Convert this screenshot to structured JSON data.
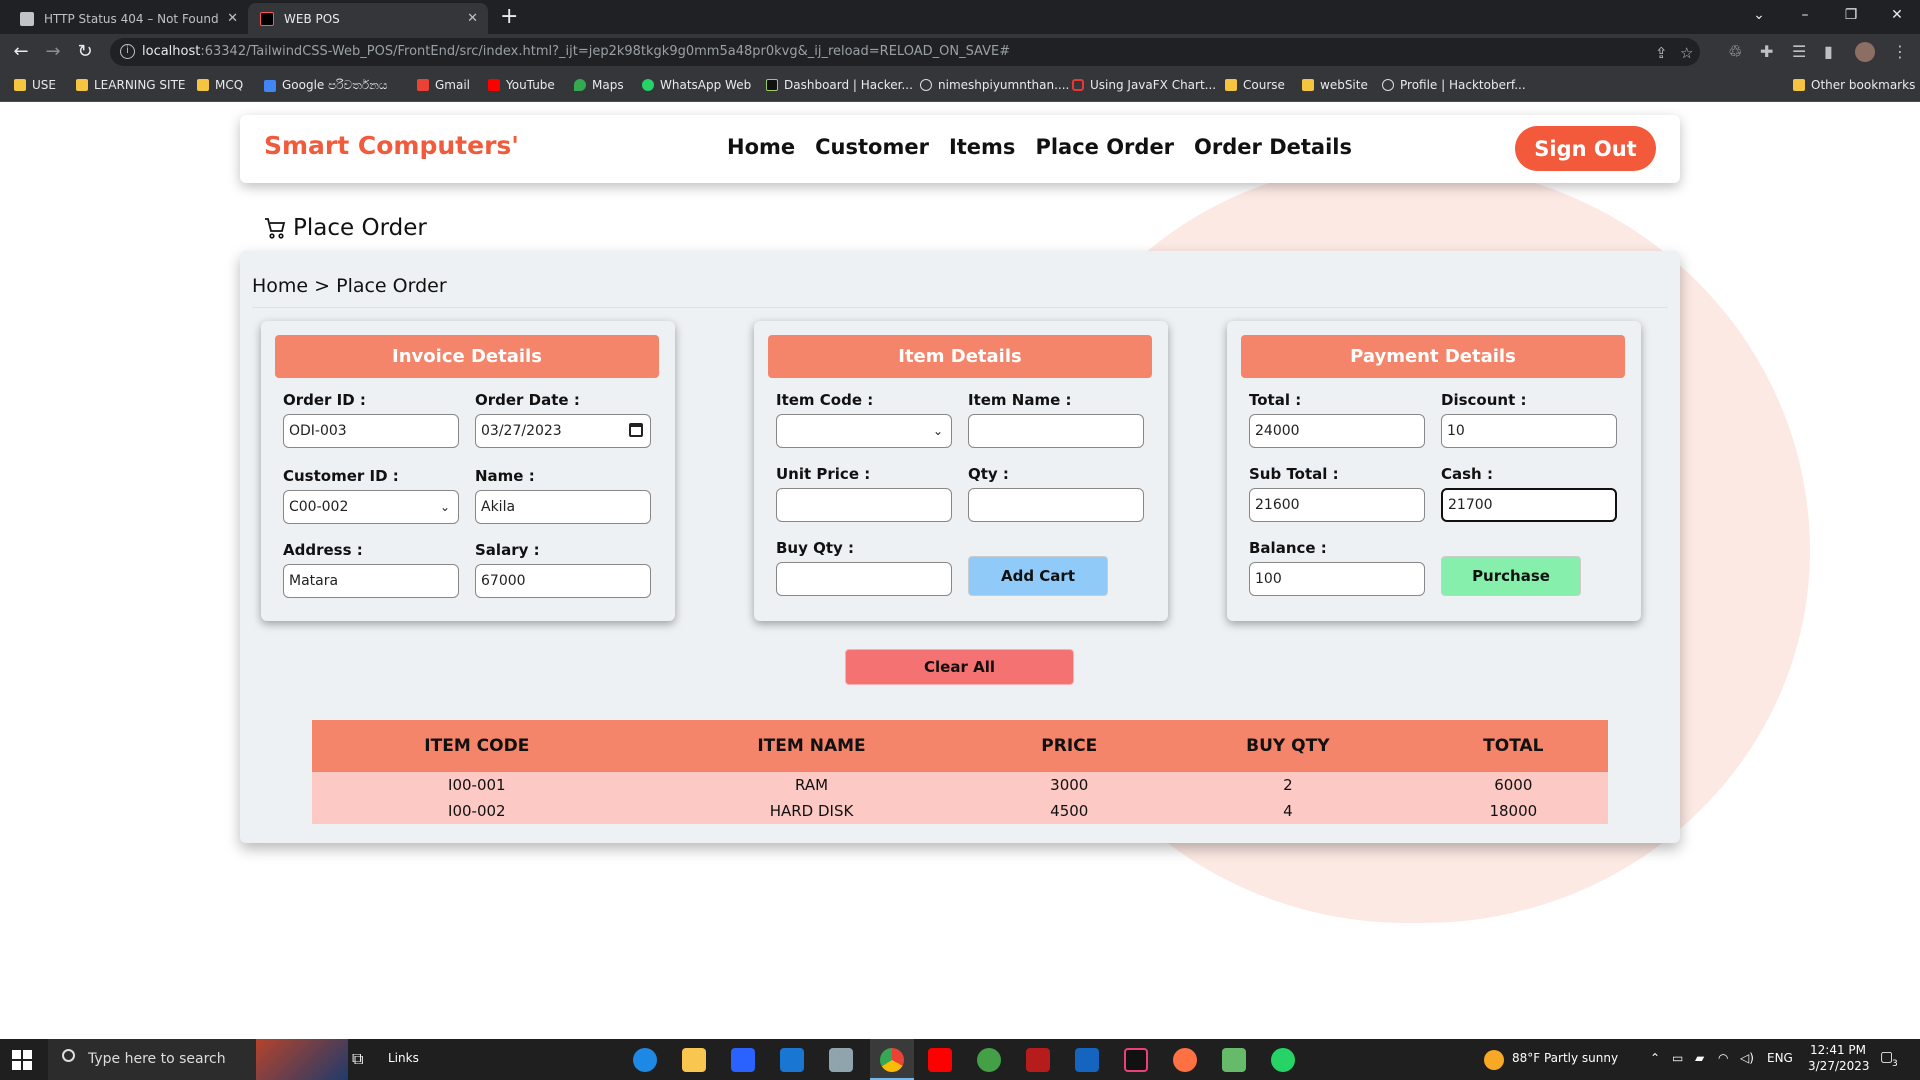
{
  "browser": {
    "tabs": [
      {
        "title": "HTTP Status 404 – Not Found"
      },
      {
        "title": "WEB POS"
      }
    ],
    "url_host": "localhost",
    "url_rest": ":63342/TailwindCSS-Web_POS/FrontEnd/src/index.html?_ijt=jep2k98tkgk9g0mm5a48pr0kvg&_ij_reload=RELOAD_ON_SAVE#",
    "bookmarks": [
      "USE",
      "LEARNING SITE",
      "MCQ",
      "Google පරිවර්තනය",
      "Gmail",
      "YouTube",
      "Maps",
      "WhatsApp Web",
      "Dashboard | Hacker...",
      "nimeshpiyumnthan....",
      "Using JavaFX Chart...",
      "Course",
      "webSite",
      "Profile | Hacktoberf...",
      "Other bookmarks"
    ]
  },
  "navbar": {
    "brand": "Smart Computers'",
    "links": [
      "Home",
      "Customer",
      "Items",
      "Place Order",
      "Order Details"
    ],
    "sign_out": "Sign Out"
  },
  "page": {
    "heading": "Place Order",
    "breadcrumb": "Home > Place Order"
  },
  "invoice": {
    "title": "Invoice Details",
    "order_id_label": "Order ID :",
    "order_id": "ODI-003",
    "order_date_label": "Order Date :",
    "order_date": "03/27/2023",
    "customer_id_label": "Customer ID :",
    "customer_id": "C00-002",
    "name_label": "Name :",
    "name": "Akila",
    "address_label": "Address :",
    "address": "Matara",
    "salary_label": "Salary :",
    "salary": "67000"
  },
  "item": {
    "title": "Item Details",
    "item_code_label": "Item Code :",
    "item_code": "",
    "item_name_label": "Item Name :",
    "item_name": "",
    "unit_price_label": "Unit Price :",
    "unit_price": "",
    "qty_label": "Qty :",
    "qty": "",
    "buy_qty_label": "Buy Qty :",
    "buy_qty": "",
    "add_cart": "Add Cart"
  },
  "payment": {
    "title": "Payment Details",
    "total_label": "Total :",
    "total": "24000",
    "discount_label": "Discount :",
    "discount": "10",
    "sub_total_label": "Sub Total :",
    "sub_total": "21600",
    "cash_label": "Cash :",
    "cash": "21700",
    "balance_label": "Balance :",
    "balance": "100",
    "purchase": "Purchase"
  },
  "clear_all": "Clear All",
  "cart_table": {
    "headers": [
      "ITEM CODE",
      "ITEM NAME",
      "PRICE",
      "BUY QTY",
      "TOTAL"
    ],
    "rows": [
      [
        "I00-001",
        "RAM",
        "3000",
        "2",
        "6000"
      ],
      [
        "I00-002",
        "HARD DISK",
        "4500",
        "4",
        "18000"
      ]
    ]
  },
  "taskbar": {
    "search_placeholder": "Type here to search",
    "links": "Links",
    "weather": "88°F  Partly sunny",
    "lang": "ENG",
    "time": "12:41 PM",
    "date": "3/27/2023",
    "notifications": "3"
  },
  "colors": {
    "brand": "#f15a3a",
    "panel_header": "#f5856a",
    "table_row": "#fcc9c4",
    "add_cart": "#90caf9",
    "purchase": "#86efac",
    "clear_all": "#f47272"
  }
}
